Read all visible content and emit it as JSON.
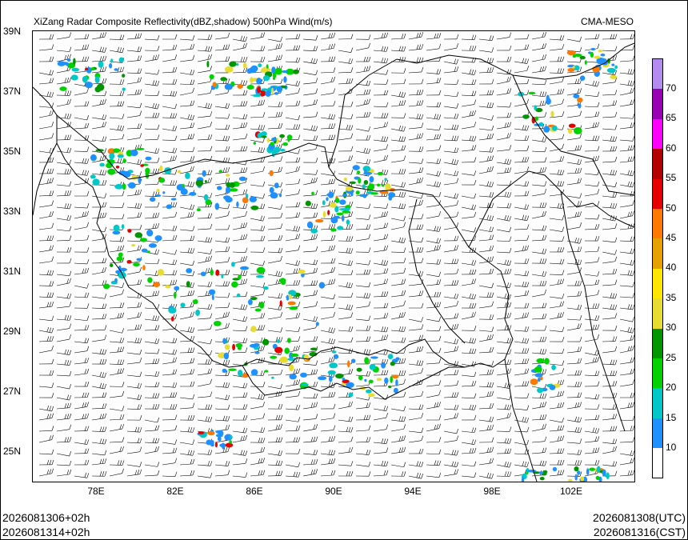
{
  "map": {
    "title_left": "XiZang Radar Composite Reflectivity(dBZ,shadow) 500hPa Wind(m/s)",
    "title_right": "CMA-MESO",
    "lat_labels": [
      "39N",
      "37N",
      "35N",
      "33N",
      "31N",
      "29N",
      "27N",
      "25N"
    ],
    "lon_labels": [
      "78E",
      "82E",
      "86E",
      "90E",
      "94E",
      "98E",
      "102E"
    ]
  },
  "colorbar": {
    "labels": [
      "70",
      "65",
      "60",
      "55",
      "50",
      "45",
      "40",
      "35",
      "30",
      "25",
      "20",
      "15",
      "10"
    ],
    "colors": [
      "#ffffff",
      "#1e90ff",
      "#00c8c8",
      "#00d200",
      "#009600",
      "#e6dc32",
      "#ffe600",
      "#e6a000",
      "#ff7800",
      "#e60000",
      "#b40000",
      "#ff00ff",
      "#9a00b4",
      "#b48cf0"
    ]
  },
  "footer": {
    "left_line1": "2026081306+02h",
    "left_line2": "2026081314+02h",
    "right_line1": "2026081308(UTC)",
    "right_line2": "2026081316(CST)"
  }
}
